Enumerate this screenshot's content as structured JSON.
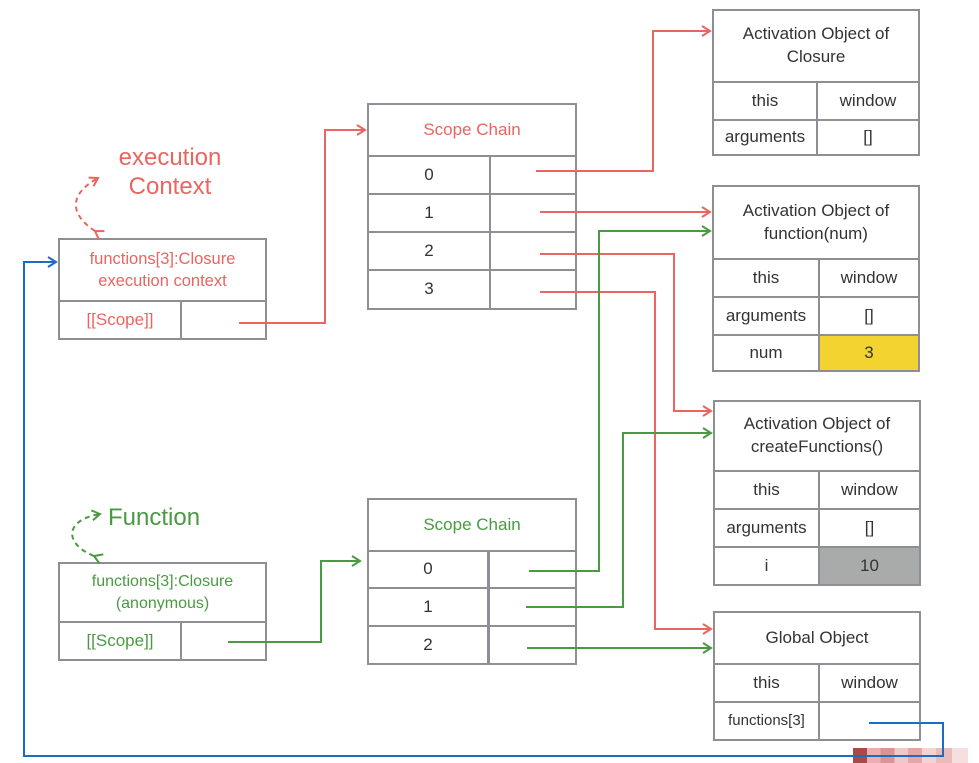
{
  "colors": {
    "red": "#ea6560",
    "green": "#4a9a42",
    "blue": "#1c6cc4",
    "border": "#8d8f94",
    "highlight_yellow": "#f2d330",
    "highlight_grey": "#a9abaa"
  },
  "labels": {
    "execution_context": [
      "execution",
      "Context"
    ],
    "function": "Function"
  },
  "closure_exec_context": {
    "title": [
      "functions[3]:Closure",
      "execution context"
    ],
    "scope_label": "[[Scope]]"
  },
  "closure_function": {
    "title": [
      "functions[3]:Closure",
      "(anonymous)"
    ],
    "scope_label": "[[Scope]]"
  },
  "scope_chain_red": {
    "title": "Scope Chain",
    "rows": [
      "0",
      "1",
      "2",
      "3"
    ]
  },
  "scope_chain_green": {
    "title": "Scope Chain",
    "rows": [
      "0",
      "1",
      "2"
    ]
  },
  "ao_closure": {
    "title": [
      "Activation Object of",
      "Closure"
    ],
    "rows": [
      {
        "key": "this",
        "value": "window"
      },
      {
        "key": "arguments",
        "value": "[]"
      }
    ]
  },
  "ao_function_num": {
    "title": [
      "Activation Object of",
      "function(num)"
    ],
    "rows": [
      {
        "key": "this",
        "value": "window"
      },
      {
        "key": "arguments",
        "value": "[]"
      },
      {
        "key": "num",
        "value": "3"
      }
    ]
  },
  "ao_create_functions": {
    "title": [
      "Activation Object of",
      "createFunctions()"
    ],
    "rows": [
      {
        "key": "this",
        "value": "window"
      },
      {
        "key": "arguments",
        "value": "[]"
      },
      {
        "key": "i",
        "value": "10"
      }
    ]
  },
  "global_object": {
    "title": "Global Object",
    "rows": [
      {
        "key": "this",
        "value": "window"
      },
      {
        "key": "functions[3]",
        "value": ""
      }
    ]
  },
  "connections": [
    {
      "from": "closure_exec_context.scope",
      "to": "scope_chain_red",
      "color": "red"
    },
    {
      "from": "scope_chain_red.0",
      "to": "ao_closure",
      "color": "red"
    },
    {
      "from": "scope_chain_red.1",
      "to": "ao_function_num",
      "color": "red"
    },
    {
      "from": "scope_chain_red.2",
      "to": "ao_create_functions",
      "color": "red"
    },
    {
      "from": "scope_chain_red.3",
      "to": "global_object",
      "color": "red"
    },
    {
      "from": "closure_function.scope",
      "to": "scope_chain_green",
      "color": "green"
    },
    {
      "from": "scope_chain_green.0",
      "to": "ao_function_num",
      "color": "green"
    },
    {
      "from": "scope_chain_green.1",
      "to": "ao_create_functions",
      "color": "green"
    },
    {
      "from": "scope_chain_green.2",
      "to": "global_object",
      "color": "green"
    },
    {
      "from": "global_object.functions[3]",
      "to": "closure_exec_context",
      "color": "blue"
    }
  ]
}
